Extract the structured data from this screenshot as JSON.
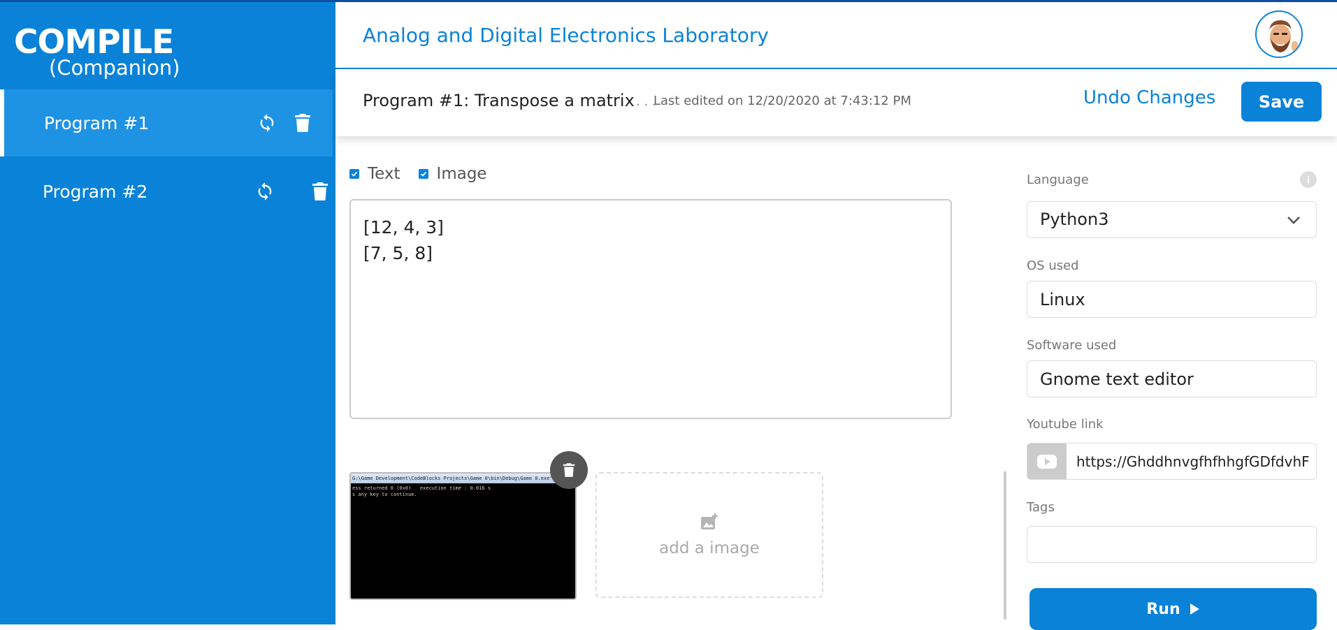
{
  "brand": {
    "name": "COMPILE",
    "sub": "(Companion)"
  },
  "sidebar": {
    "items": [
      {
        "label": "Program #1",
        "active": true
      },
      {
        "label": "Program #2",
        "active": false
      }
    ]
  },
  "header": {
    "lab_title": "Analog and Digital Electronics Laboratory"
  },
  "program": {
    "title": "Program #1: Transpose a matrix",
    "ellipsis": ". . .",
    "last_edited": "Last edited on 12/20/2020 at 7:43:12 PM",
    "undo_label": "Undo Changes",
    "save_label": "Save"
  },
  "content": {
    "text_checkbox_label": "Text",
    "image_checkbox_label": "Image",
    "text_checked": true,
    "image_checked": true,
    "editor_text": "[12, 4, 3]\n[7, 5, 8]",
    "thumbnail": {
      "titlebar": "G:\\Game Development\\CodeBlocks Projects\\Game 0\\bin\\Debug\\Game 0.exe\"",
      "console": "ess returned 0 (0x0)   execution time : 0.016 s\ns any key to continue."
    },
    "add_image_label": "add a image"
  },
  "settings": {
    "language_label": "Language",
    "language_value": "Python3",
    "os_label": "OS used",
    "os_value": "Linux",
    "software_label": "Software used",
    "software_value": "Gnome text editor",
    "youtube_label": "Youtube link",
    "youtube_value": "https://GhddhnvgfhfhhgfGDfdvhFs",
    "tags_label": "Tags",
    "tags_value": "",
    "run_label": "Run"
  },
  "icons": {
    "refresh": "refresh-icon",
    "trash": "trash-icon",
    "info": "info-icon",
    "chevron": "chevron-down-icon",
    "youtube": "youtube-icon",
    "add_photo": "add-photo-icon",
    "play": "play-icon"
  },
  "colors": {
    "primary": "#0a82d8",
    "sidebar_active": "#1f93e3",
    "header_line": "#0d4f9e"
  }
}
